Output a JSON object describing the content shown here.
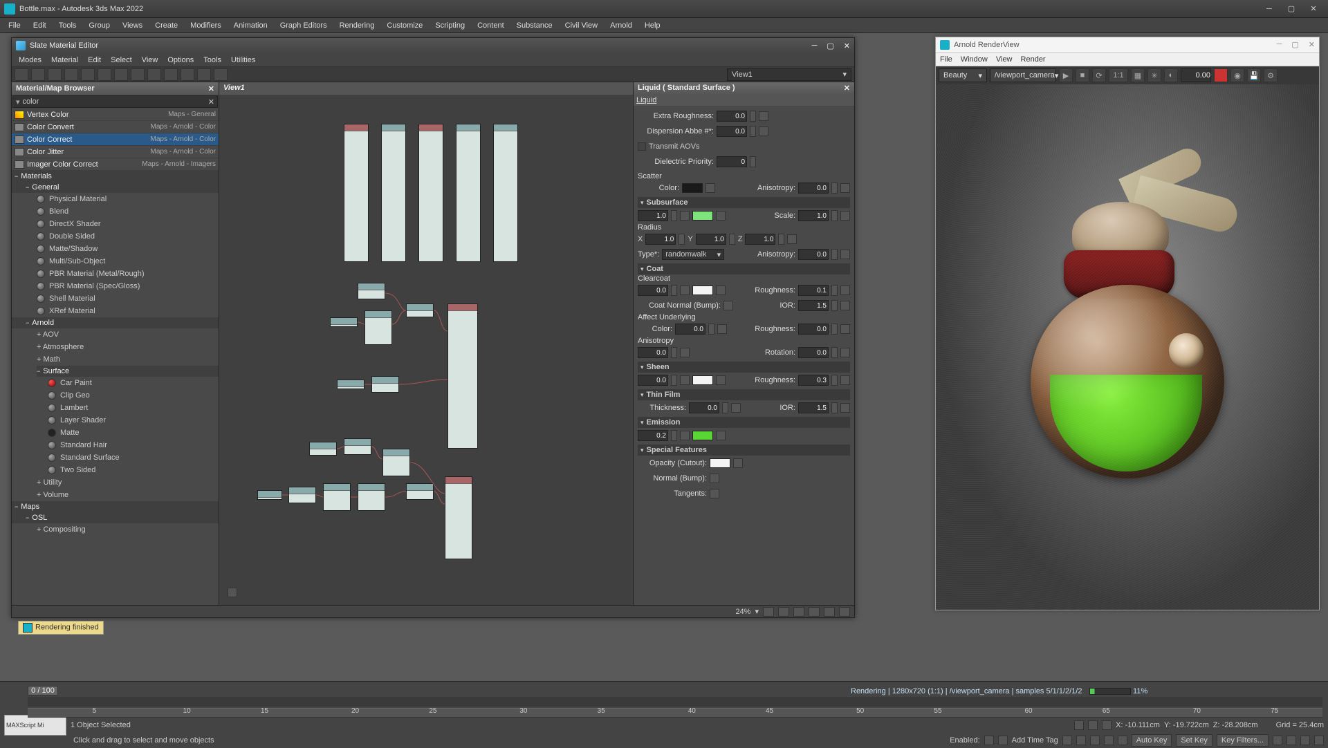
{
  "app": {
    "title": "Bottle.max - Autodesk 3ds Max 2022",
    "menu": [
      "File",
      "Edit",
      "Tools",
      "Group",
      "Views",
      "Create",
      "Modifiers",
      "Animation",
      "Graph Editors",
      "Rendering",
      "Customize",
      "Scripting",
      "Content",
      "Substance",
      "Civil View",
      "Arnold",
      "Help"
    ]
  },
  "sme": {
    "title": "Slate Material Editor",
    "menu": [
      "Modes",
      "Material",
      "Edit",
      "Select",
      "View",
      "Options",
      "Tools",
      "Utilities"
    ],
    "view_selector": "View1",
    "browser": {
      "title": "Material/Map Browser",
      "search": "color",
      "color_items": [
        {
          "label": "Vertex Color",
          "meta": "Maps - General"
        },
        {
          "label": "Color Convert",
          "meta": "Maps - Arnold - Color"
        },
        {
          "label": "Color Correct",
          "meta": "Maps - Arnold - Color",
          "sel": true
        },
        {
          "label": "Color Jitter",
          "meta": "Maps - Arnold - Color"
        },
        {
          "label": "Imager Color Correct",
          "meta": "Maps - Arnold - Imagers"
        }
      ],
      "cats": {
        "materials": "Materials",
        "general": "General",
        "general_items": [
          "Physical Material",
          "Blend",
          "DirectX Shader",
          "Double Sided",
          "Matte/Shadow",
          "Multi/Sub-Object",
          "PBR Material (Metal/Rough)",
          "PBR Material (Spec/Gloss)",
          "Shell Material",
          "XRef Material"
        ],
        "arnold": "Arnold",
        "arnold_sub": [
          "+ AOV",
          "+ Atmosphere",
          "+ Math"
        ],
        "surface": "Surface",
        "surface_items": [
          "Car Paint",
          "Clip Geo",
          "Lambert",
          "Layer Shader",
          "Matte",
          "Standard Hair",
          "Standard Surface",
          "Two Sided"
        ],
        "arnold_sub2": [
          "+ Utility",
          "+ Volume"
        ],
        "maps": "Maps",
        "osl": "OSL",
        "compositing": "+ Compositing"
      }
    },
    "graph": {
      "title": "View1"
    },
    "param": {
      "title": "Liquid  ( Standard Surface )",
      "sub": "Liquid",
      "extra_roughness_lbl": "Extra Roughness:",
      "extra_roughness": "0.0",
      "dispersion_lbl": "Dispersion Abbe #*:",
      "dispersion": "0.0",
      "transmit_aovs": "Transmit AOVs",
      "dielectric_lbl": "Dielectric Priority:",
      "dielectric": "0",
      "scatter": "Scatter",
      "color_lbl": "Color:",
      "scatter_color": "#1a1a1a",
      "aniso_lbl": "Anisotropy:",
      "aniso": "0.0",
      "subsurface": "Subsurface",
      "subsurface_w": "1.0",
      "subsurface_color": "#7ee37a",
      "scale_lbl": "Scale:",
      "scale": "1.0",
      "radius": "Radius",
      "rx": "1.0",
      "ry": "1.0",
      "rz": "1.0",
      "type_lbl": "Type*:",
      "type_val": "randomwalk",
      "ss_aniso": "0.0",
      "coat": "Coat",
      "clearcoat": "Clearcoat",
      "coat_w": "0.0",
      "coat_color": "#f4f4f4",
      "rough_lbl": "Roughness:",
      "coat_rough": "0.1",
      "coat_normal": "Coat Normal (Bump):",
      "ior_lbl": "IOR:",
      "coat_ior": "1.5",
      "affect": "Affect Underlying",
      "affect_color": "0.0",
      "affect_rough": "0.0",
      "anisotropy": "Anisotropy",
      "ani_v": "0.0",
      "rot_lbl": "Rotation:",
      "rot_v": "0.0",
      "sheen": "Sheen",
      "sheen_w": "0.0",
      "sheen_color": "#f4f4f4",
      "sheen_rough": "0.3",
      "thinfilm": "Thin Film",
      "thick_lbl": "Thickness:",
      "thick": "0.0",
      "tf_ior": "1.5",
      "emission": "Emission",
      "em_w": "0.2",
      "em_color": "#59d633",
      "special": "Special Features",
      "opacity_lbl": "Opacity (Cutout):",
      "opacity_color": "#f4f4f4",
      "normal_lbl": "Normal (Bump):",
      "tangents_lbl": "Tangents:"
    },
    "status": {
      "rendering": "Rendering finished",
      "zoom": "24%"
    }
  },
  "arnold": {
    "title": "Arnold RenderView",
    "menu": [
      "File",
      "Window",
      "View",
      "Render"
    ],
    "aov": "Beauty",
    "camera": "/viewport_camera",
    "ratio": "1:1",
    "exposure": "0.00"
  },
  "timeline": {
    "frame": "0 / 100",
    "marks": [
      "5",
      "10",
      "15",
      "20",
      "25",
      "30",
      "35",
      "40",
      "45",
      "50",
      "55",
      "60",
      "65",
      "70",
      "75"
    ]
  },
  "status": {
    "render": "Rendering | 1280x720 (1:1) | /viewport_camera | samples 5/1/1/2/1/2",
    "pct": "11%",
    "sel": "1 Object Selected",
    "hint": "Click and drag to select and move objects",
    "x": "X: -10.111cm",
    "y": "Y: -19.722cm",
    "z": "Z: -28.208cm",
    "enabled": "Enabled:",
    "addtime": "Add Time Tag",
    "setkey": "Set Key",
    "keyfilt": "Key Filters...",
    "grid": "Grid = 25.4cm",
    "autokey": "Auto Key"
  }
}
